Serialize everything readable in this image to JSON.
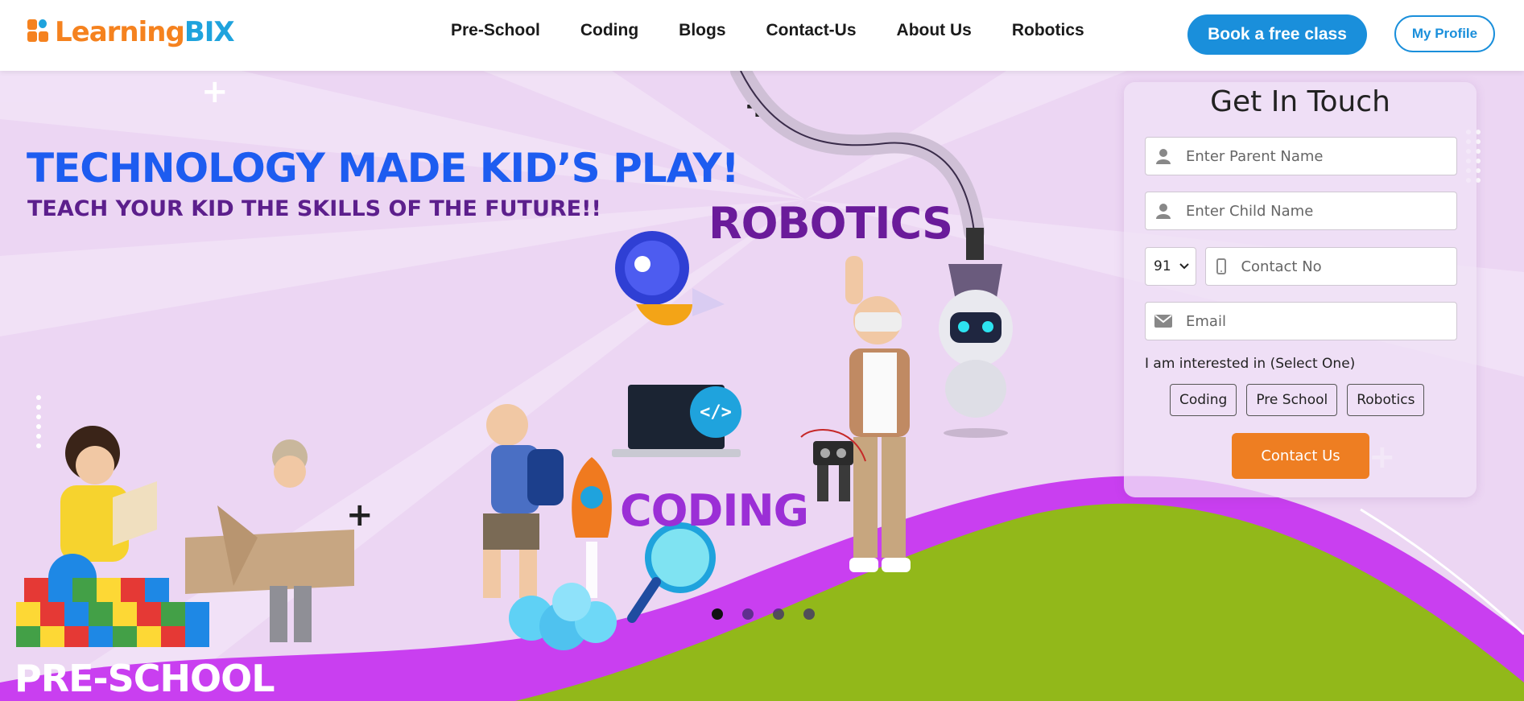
{
  "header": {
    "logo": {
      "part1": "Learning",
      "part2": "BIX"
    },
    "nav": [
      "Pre-School",
      "Coding",
      "Blogs",
      "Contact-Us",
      "About Us",
      "Robotics"
    ],
    "book_label": "Book a free class",
    "profile_label": "My Profile"
  },
  "hero": {
    "title": "TECHNOLOGY MADE KID’S PLAY!",
    "subtitle": "TEACH YOUR KID THE SKILLS OF THE FUTURE!!",
    "label_robotics": "ROBOTICS",
    "label_coding": "CODING",
    "label_preschool": "PRE-SCHOOL",
    "code_tag": "</>",
    "carousel": {
      "total": 4,
      "active": 1
    }
  },
  "form": {
    "title": "Get In Touch",
    "parent_placeholder": "Enter Parent Name",
    "child_placeholder": "Enter Child Name",
    "country_code": "91",
    "contact_placeholder": "Contact No",
    "email_placeholder": "Email",
    "interest_label": "I am interested in (Select One)",
    "options": [
      "Coding",
      "Pre School",
      "Robotics"
    ],
    "submit_label": "Contact Us"
  },
  "colors": {
    "brand_orange": "#f5821f",
    "brand_blue": "#1fa3dd",
    "button_blue": "#1a8fdb",
    "title_blue": "#1d5cf0",
    "purple": "#6a1b9a",
    "hero_bg": "#ecd6f3",
    "wave_magenta": "#c93ff0",
    "wave_green": "#92b81a",
    "contact_orange": "#ee7e22"
  }
}
